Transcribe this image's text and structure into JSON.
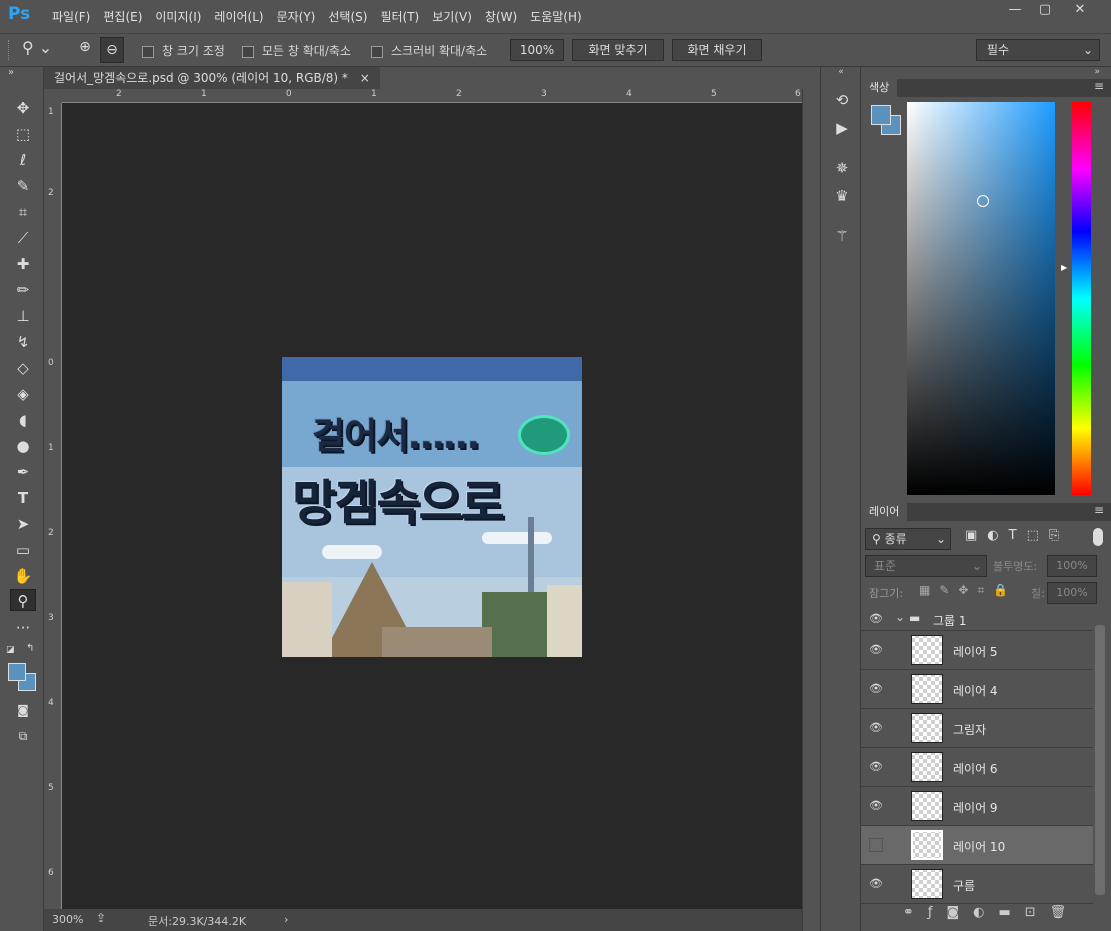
{
  "app": {
    "logo": "Ps"
  },
  "menu": [
    "파일(F)",
    "편집(E)",
    "이미지(I)",
    "레이어(L)",
    "문자(Y)",
    "선택(S)",
    "필터(T)",
    "보기(V)",
    "창(W)",
    "도움말(H)"
  ],
  "window_controls": [
    "minimize",
    "maximize",
    "close"
  ],
  "options": {
    "resize_windows": "창 크기 조정",
    "zoom_all": "모든 창 확대/축소",
    "scrubby_zoom": "스크러비 확대/축소",
    "zoom_value": "100%",
    "fit_screen": "화면 맞추기",
    "fill_screen": "화면 채우기",
    "workspace": "필수"
  },
  "document": {
    "tab_title": "걸어서_망겜속으로.psd @ 300% (레이어 10, RGB/8) *",
    "zoom_status": "300%",
    "doc_size": "문서:29.3K/344.2K",
    "ruler_h": [
      "2",
      "1",
      "0",
      "1",
      "2",
      "3",
      "4",
      "5",
      "6"
    ],
    "ruler_v": [
      "1",
      "2",
      "0",
      "1",
      "2",
      "3",
      "4",
      "5",
      "6"
    ]
  },
  "artwork": {
    "line1": "걸어서……",
    "line2": "망겜속으로"
  },
  "color_panel": {
    "tab": "색상",
    "foreground": "#5a92bd",
    "background": "#5a92bd"
  },
  "layers_panel": {
    "tab": "레이어",
    "filter_kind": "종류",
    "blend_mode": "표준",
    "opacity_label": "불투명도:",
    "opacity_value": "100%",
    "lock_label": "잠그기:",
    "fill_label": "칠:",
    "fill_value": "100%",
    "layers": [
      {
        "name": "그룹 1",
        "type": "group",
        "visible": true
      },
      {
        "name": "레이어 5",
        "visible": true
      },
      {
        "name": "레이어 4",
        "visible": true
      },
      {
        "name": "그림자",
        "visible": true
      },
      {
        "name": "레이어 6",
        "visible": true
      },
      {
        "name": "레이어 9",
        "visible": true
      },
      {
        "name": "레이어 10",
        "visible": false,
        "selected": true
      },
      {
        "name": "구름",
        "visible": true
      }
    ]
  }
}
